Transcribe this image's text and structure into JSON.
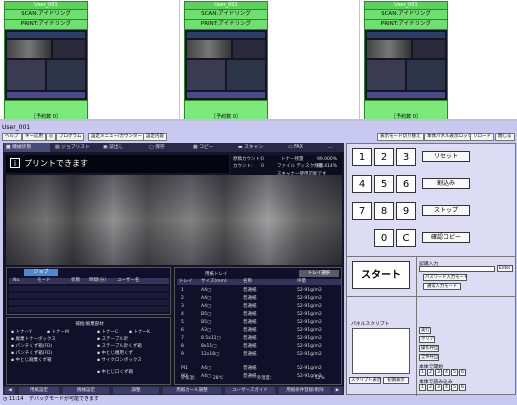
{
  "devices": [
    {
      "name": "User_001",
      "scan": "SCAN:アイドリング",
      "print": "PRINT:アイドリング",
      "reserve": "［予約数 0］"
    },
    {
      "name": "User_001",
      "scan": "SCAN:アイドリング",
      "print": "PRINT:アイドリング",
      "reserve": "［予約数 0］"
    },
    {
      "name": "User_001",
      "scan": "SCAN:アイドリング",
      "print": "PRINT:アイドリング",
      "reserve": "［予約数 0］"
    }
  ],
  "window": {
    "title": "User_001",
    "toolbar": [
      "ヘルプ",
      "キー応用",
      "◎",
      "プログラム",
      "設定メニュー/カウンター",
      "設定内容"
    ],
    "right_toolbar": [
      "表示モード切り替え",
      "本体パネル表示ロック",
      "リロード",
      "閉じる"
    ]
  },
  "menu": [
    "機械状態",
    "ジョブリスト",
    "読出し",
    "保存",
    "コピー",
    "スキャン",
    "FAX",
    "…"
  ],
  "message": {
    "icon": "i",
    "text": "プリントできます"
  },
  "counters": {
    "rows": [
      {
        "label": "原稿カウント:",
        "value": "0",
        "label2": "トナー残量",
        "value2": "99.000%"
      },
      {
        "label": "カウント:",
        "value": "0",
        "label2": "ファイル ディスク残量",
        "value2": "99.414%"
      },
      {
        "label": "",
        "value": "",
        "label2": "スキャナー使用可能です",
        "value2": ""
      }
    ]
  },
  "jobs": {
    "tab": "ジョブ",
    "headers": [
      "No.",
      "モード",
      "状態",
      "時間(分)",
      "ユーザー名"
    ]
  },
  "consumables": {
    "title": "補給/廃棄部材",
    "items": [
      "トナーY",
      "トナーM",
      "トナーC",
      "トナーK",
      "廃棄トナーボックス",
      "ステープル針",
      "パンチくず箱(FD)",
      "ステープル針くず箱",
      "パンチくず箱(FD)",
      "中とじ機用くず",
      "中とじ廃棄くず箱",
      "サイクロンボックス",
      "中とじ口くず箱"
    ]
  },
  "tray": {
    "title": "用紙トレイ",
    "select_button": "トレイ選択",
    "headers": [
      "トレイ",
      "サイズ(mm)",
      "名称",
      "坪量"
    ],
    "rows": [
      {
        "tray": "1",
        "size": "A4▢",
        "name": "普通紙",
        "weight": "52-91g/m2"
      },
      {
        "tray": "2",
        "size": "A4▢",
        "name": "普通紙",
        "weight": "52-91g/m2"
      },
      {
        "tray": "3",
        "size": "A4▢",
        "name": "普通紙",
        "weight": "52-91g/m2"
      },
      {
        "tray": "4",
        "size": "B5▢",
        "name": "普通紙",
        "weight": "52-91g/m2"
      },
      {
        "tray": "5",
        "size": "B5▢",
        "name": "普通紙",
        "weight": "52-91g/m2"
      },
      {
        "tray": "6",
        "size": "A3▢",
        "name": "普通紙",
        "weight": "52-91g/m2"
      },
      {
        "tray": "7",
        "size": "8.5x11▢",
        "name": "普通紙",
        "weight": "52-91g/m2"
      },
      {
        "tray": "8",
        "size": "8x11▢",
        "name": "普通紙",
        "weight": "52-91g/m2"
      },
      {
        "tray": "9",
        "size": "12x18▢",
        "name": "普通紙",
        "weight": "52-91g/m2"
      },
      {
        "tray": "PI1",
        "size": "A4▢",
        "name": "普通紙",
        "weight": "52-91g/m2"
      },
      {
        "tray": "PI2",
        "size": "A4▢",
        "name": "普通紙",
        "weight": "52-91g/m2"
      }
    ],
    "status": [
      "外気温：",
      "28℃",
      "外湿度：",
      "52%"
    ]
  },
  "bottom_nav": [
    "◀",
    "用紙設定",
    "機械設定",
    "調整",
    "用紙カール調整",
    "ユーザーズガイド",
    "用紙条件登録/削除",
    "▶"
  ],
  "status_bar": {
    "time": "11:14",
    "text": "デバッグモードが可能できます"
  },
  "keypad": {
    "keys": [
      "1",
      "2",
      "3",
      "4",
      "5",
      "6",
      "7",
      "8",
      "9",
      "0",
      "C"
    ],
    "buttons": [
      "リセット",
      "割込み",
      "ストップ",
      "確認コピー"
    ],
    "start": "スタート"
  },
  "auth": {
    "title": "認識入力",
    "enter": "Enter",
    "password_btn": "パスワード入力モード",
    "normal_btn": "通常入力モード"
  },
  "script": {
    "title": "パネルスクリプト",
    "show": "スクリプト表示",
    "stop": "初期表示"
  },
  "side_btns": [
    "実行",
    "クリア",
    "操作呼出",
    "全件呼出",
    "本体で開始",
    "本体で読み込み"
  ],
  "digits": [
    "1",
    "2",
    "3",
    "4",
    "5",
    "6"
  ]
}
